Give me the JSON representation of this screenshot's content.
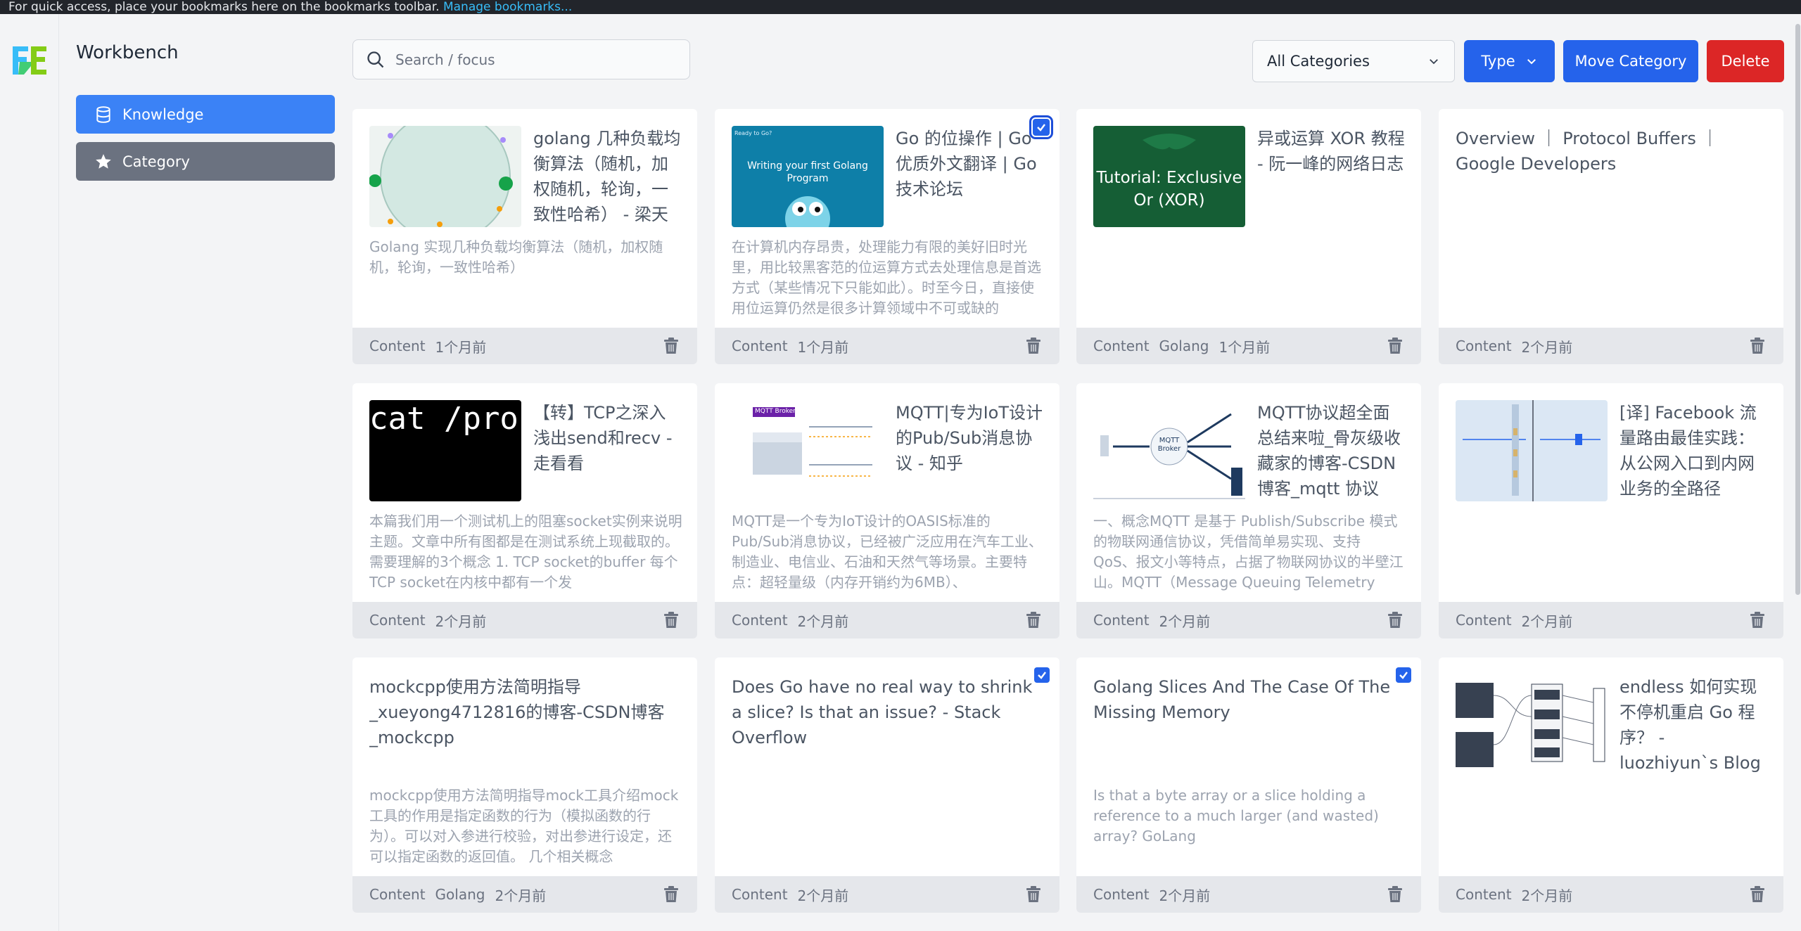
{
  "browser": {
    "bookmarks_hint": "For quick access, place your bookmarks here on the bookmarks toolbar.",
    "manage_link": "Manage bookmarks..."
  },
  "sidebar": {
    "title": "Workbench",
    "items": [
      {
        "label": "Knowledge",
        "icon": "database-icon",
        "active": true
      },
      {
        "label": "Category",
        "icon": "star-icon",
        "active": false
      }
    ]
  },
  "toolbar": {
    "search_placeholder": "Search / focus",
    "category_select": "All Categories",
    "type_label": "Type",
    "move_label": "Move Category",
    "delete_label": "Delete"
  },
  "colors": {
    "primary": "#2563eb",
    "active_nav": "#3b82f6",
    "secondary_nav": "#6b7280",
    "danger": "#dc2626"
  },
  "cards": [
    {
      "title": "golang 几种负载均衡算法（随机，加权随机，轮询，一致性哈希） - 梁天",
      "desc": "Golang 实现几种负载均衡算法（随机，加权随机，轮询，一致性哈希）",
      "tags": [
        "Content"
      ],
      "time": "1个月前",
      "thumb": "circle",
      "checked": false
    },
    {
      "title": "Go 的位操作 | Go优质外文翻译 | Go 技术论坛",
      "desc": "在计算机内存昂贵，处理能力有限的美好旧时光里，用比较黑客范的位运算方式去处理信息是首选方式（某些情况下只能如此）。时至今日，直接使用位运算仍然是很多计算领域中不可或缺的",
      "tags": [
        "Content"
      ],
      "time": "1个月前",
      "thumb": "gopher",
      "thumb_text_top": "Ready to Go?",
      "thumb_text": "Writing your first Golang Program",
      "checked": true,
      "focus": true
    },
    {
      "title": "异或运算 XOR 教程 - 阮一峰的网络日志",
      "desc": "",
      "tags": [
        "Content",
        "Golang"
      ],
      "time": "1个月前",
      "thumb": "xor",
      "thumb_text": "Tutorial: Exclusive Or (XOR)",
      "checked": false
    },
    {
      "title": "Overview ｜ Protocol Buffers ｜ Google Developers",
      "desc": "",
      "tags": [
        "Content"
      ],
      "time": "2个月前",
      "thumb": "none",
      "checked": false
    },
    {
      "title": "【转】TCP之深入浅出send和recv - 走看看",
      "desc": "本篇我们用一个测试机上的阻塞socket实例来说明主题。文章中所有图都是在测试系统上现截取的。 需要理解的3个概念 1. TCP socket的buffer 每个TCP socket在内核中都有一个发",
      "tags": [
        "Content"
      ],
      "time": "2个月前",
      "thumb": "terminal",
      "thumb_text": "cat /proc/",
      "checked": false
    },
    {
      "title": "MQTT|专为IoT设计的Pub/Sub消息协议 - 知乎",
      "desc": "MQTT是一个专为IoT设计的OASIS标准的Pub/Sub消息协议，已经被广泛应用在汽车工业、制造业、电信业、石油和天然气等场景。主要特点：超轻量级（内存开销约为6MB）、",
      "tags": [
        "Content"
      ],
      "time": "2个月前",
      "thumb": "mqtt-broker",
      "thumb_text": "MQTT Broker",
      "checked": false
    },
    {
      "title": "MQTT协议超全面总结来啦_骨灰级收藏家的博客-CSDN博客_mqtt 协议",
      "desc": "一、概念MQTT 是基于 Publish/Subscribe 模式的物联网通信协议，凭借简单易实现、支持 QoS、报文小等特点，占据了物联网协议的半壁江山。MQTT（Message Queuing Telemetry",
      "tags": [
        "Content"
      ],
      "time": "2个月前",
      "thumb": "mqtt-diagram",
      "thumb_text": "MQTT Broker",
      "checked": false
    },
    {
      "title": "[译] Facebook 流量路由最佳实践：从公网入口到内网业务的全路径",
      "desc": "",
      "tags": [
        "Content"
      ],
      "time": "2个月前",
      "thumb": "network",
      "checked": false
    },
    {
      "title": "mockcpp使用方法简明指导_xueyong4712816的博客-CSDN博客_mockcpp",
      "desc": "mockcpp使用方法简明指导mock工具介绍mock工具的作用是指定函数的行为（模拟函数的行为）。可以对入参进行校验，对出参进行设定，还可以指定函数的返回值。 几个相关概念",
      "tags": [
        "Content",
        "Golang"
      ],
      "time": "2个月前",
      "thumb": "none",
      "checked": false
    },
    {
      "title": "Does Go have no real way to shrink a slice? Is that an issue? - Stack Overflow",
      "desc": "",
      "tags": [
        "Content"
      ],
      "time": "2个月前",
      "thumb": "none",
      "checked": true
    },
    {
      "title": "Golang Slices And The Case Of The Missing Memory",
      "desc": "Is that a byte array or a slice holding a reference to a much larger (and wasted) array? GoLang",
      "tags": [
        "Content"
      ],
      "time": "2个月前",
      "thumb": "none",
      "checked": true
    },
    {
      "title": "endless 如何实现不停机重启 Go 程序？ - luozhiyun`s Blog",
      "desc": "",
      "tags": [
        "Content"
      ],
      "time": "2个月前",
      "thumb": "flow",
      "checked": false
    }
  ]
}
